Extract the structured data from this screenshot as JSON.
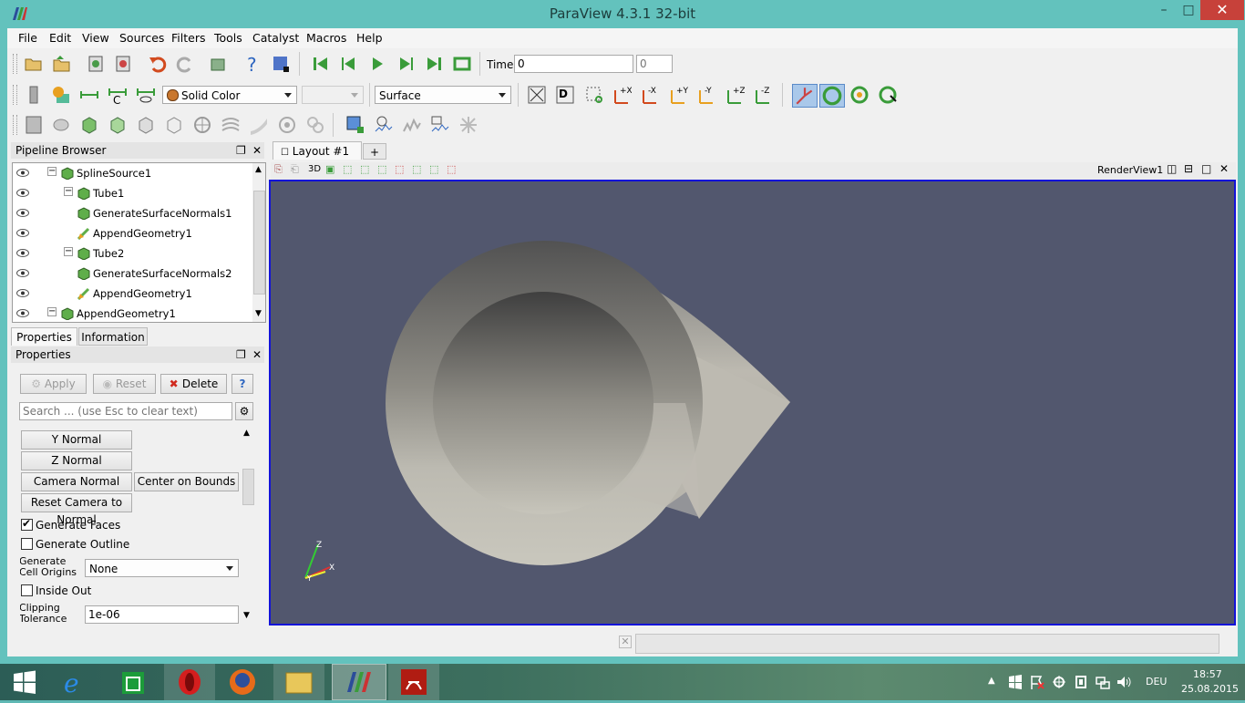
{
  "window": {
    "title": "ParaView 4.3.1 32-bit",
    "min": "–",
    "max": "□",
    "close": "✕"
  },
  "menubar": [
    "File",
    "Edit",
    "View",
    "Sources",
    "Filters",
    "Tools",
    "Catalyst",
    "Macros",
    "Help"
  ],
  "toolbar": {
    "time_label": "Time:",
    "time_value": "0",
    "time_index": "0",
    "color_by": "Solid Color",
    "color_component": "",
    "representation": "Surface"
  },
  "pipeline_browser": {
    "title": "Pipeline Browser",
    "items": [
      {
        "label": "SplineSource1",
        "depth": 1,
        "expander": "−"
      },
      {
        "label": "Tube1",
        "depth": 2,
        "expander": "−"
      },
      {
        "label": "GenerateSurfaceNormals1",
        "depth": 3,
        "expander": ""
      },
      {
        "label": "AppendGeometry1",
        "depth": 3,
        "expander": ""
      },
      {
        "label": "Tube2",
        "depth": 2,
        "expander": "−"
      },
      {
        "label": "GenerateSurfaceNormals2",
        "depth": 3,
        "expander": ""
      },
      {
        "label": "AppendGeometry1",
        "depth": 3,
        "expander": ""
      },
      {
        "label": "AppendGeometry1",
        "depth": 1,
        "expander": "−"
      }
    ]
  },
  "tabs": {
    "properties": "Properties",
    "information": "Information"
  },
  "properties": {
    "title": "Properties",
    "apply": "Apply",
    "reset": "Reset",
    "delete": "Delete",
    "help": "?",
    "search_placeholder": "Search ... (use Esc to clear text)",
    "y_normal": "Y Normal",
    "z_normal": "Z Normal",
    "camera_normal": "Camera Normal",
    "center_on_bounds": "Center on Bounds",
    "reset_camera_to_normal": "Reset Camera to Normal",
    "generate_faces": "Generate Faces",
    "generate_faces_checked": true,
    "generate_outline": "Generate Outline",
    "generate_outline_checked": false,
    "generate_cell_origins_label": "Generate Cell Origins",
    "generate_cell_origins_value": "None",
    "inside_out": "Inside Out",
    "inside_out_checked": false,
    "clipping_tolerance_label": "Clipping Tolerance",
    "clipping_tolerance_value": "1e-06"
  },
  "layout": {
    "tab": "Layout #1",
    "add": "+",
    "view_name": "RenderView1",
    "mode_3d": "3D"
  },
  "axes": {
    "z": "Z",
    "x": "X",
    "y": "Y"
  },
  "taskbar": {
    "lang": "DEU",
    "time": "18:57",
    "date": "25.08.2015"
  },
  "colors": {
    "viewport_bg": "#52576e",
    "active_border": "#1313d8",
    "surface": "#c9c7bd",
    "titlebar": "#63c2bd"
  }
}
